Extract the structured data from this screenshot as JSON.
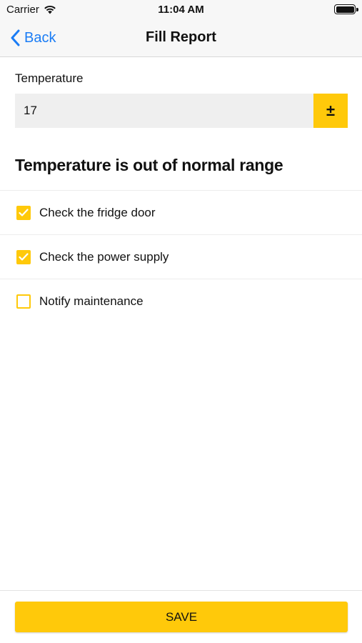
{
  "status_bar": {
    "carrier": "Carrier",
    "time": "11:04 AM",
    "wifi_icon": "wifi-icon",
    "battery_icon": "battery-icon"
  },
  "nav": {
    "back_label": "Back",
    "back_icon": "chevron-left-icon",
    "title": "Fill Report"
  },
  "form": {
    "temperature_label": "Temperature",
    "temperature_value": "17",
    "sign_toggle_label": "±"
  },
  "warning": "Temperature is out of normal range",
  "checklist": [
    {
      "label": "Check the fridge door",
      "checked": true
    },
    {
      "label": "Check the power supply",
      "checked": true
    },
    {
      "label": "Notify maintenance",
      "checked": false
    }
  ],
  "footer": {
    "save_label": "SAVE"
  },
  "colors": {
    "accent": "#ffc90a",
    "link": "#1a7cf5",
    "input_bg": "#efefef"
  }
}
